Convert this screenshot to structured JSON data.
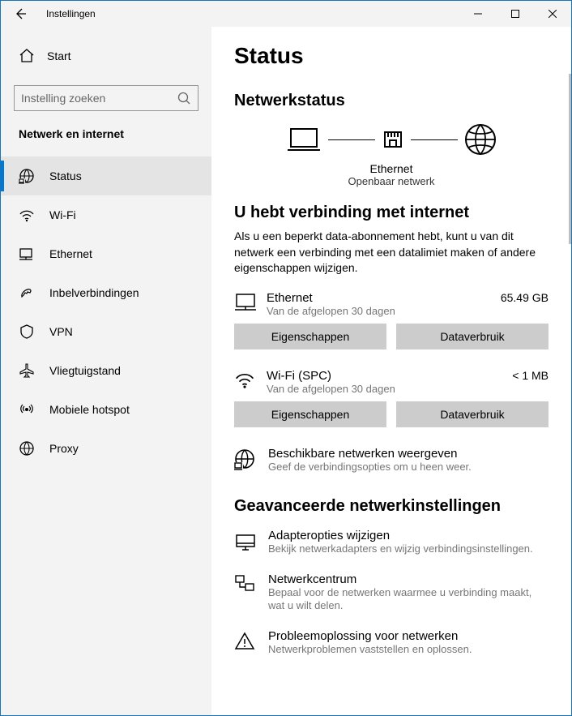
{
  "window": {
    "title": "Instellingen"
  },
  "sidebar": {
    "home": "Start",
    "search_placeholder": "Instelling zoeken",
    "category": "Netwerk en internet",
    "items": [
      {
        "label": "Status",
        "icon": "status-icon",
        "active": true
      },
      {
        "label": "Wi-Fi",
        "icon": "wifi-icon",
        "active": false
      },
      {
        "label": "Ethernet",
        "icon": "ethernet-icon",
        "active": false
      },
      {
        "label": "Inbelverbindingen",
        "icon": "dialup-icon",
        "active": false
      },
      {
        "label": "VPN",
        "icon": "vpn-icon",
        "active": false
      },
      {
        "label": "Vliegtuigstand",
        "icon": "airplane-icon",
        "active": false
      },
      {
        "label": "Mobiele hotspot",
        "icon": "hotspot-icon",
        "active": false
      },
      {
        "label": "Proxy",
        "icon": "proxy-icon",
        "active": false
      }
    ]
  },
  "main": {
    "title": "Status",
    "netstatus_heading": "Netwerkstatus",
    "diagram": {
      "name": "Ethernet",
      "type": "Openbaar netwerk"
    },
    "connected_heading": "U hebt verbinding met internet",
    "connected_desc": "Als u een beperkt data-abonnement hebt, kunt u van dit netwerk een verbinding met een datalimiet maken of andere eigenschappen wijzigen.",
    "nets": [
      {
        "name": "Ethernet",
        "sub": "Van de afgelopen 30 dagen",
        "usage": "65.49 GB",
        "props": "Eigenschappen",
        "data": "Dataverbruik"
      },
      {
        "name": "Wi-Fi (SPC)",
        "sub": "Van de afgelopen 30 dagen",
        "usage": "< 1 MB",
        "props": "Eigenschappen",
        "data": "Dataverbruik"
      }
    ],
    "show_networks": {
      "name": "Beschikbare netwerken weergeven",
      "sub": "Geef de verbindingsopties om u heen weer."
    },
    "advanced_heading": "Geavanceerde netwerkinstellingen",
    "advanced": [
      {
        "name": "Adapteropties wijzigen",
        "sub": "Bekijk netwerkadapters en wijzig verbindingsinstellingen."
      },
      {
        "name": "Netwerkcentrum",
        "sub": "Bepaal voor de netwerken waarmee u verbinding maakt, wat u wilt delen."
      },
      {
        "name": "Probleemoplossing voor netwerken",
        "sub": "Netwerkproblemen vaststellen en oplossen."
      }
    ]
  }
}
